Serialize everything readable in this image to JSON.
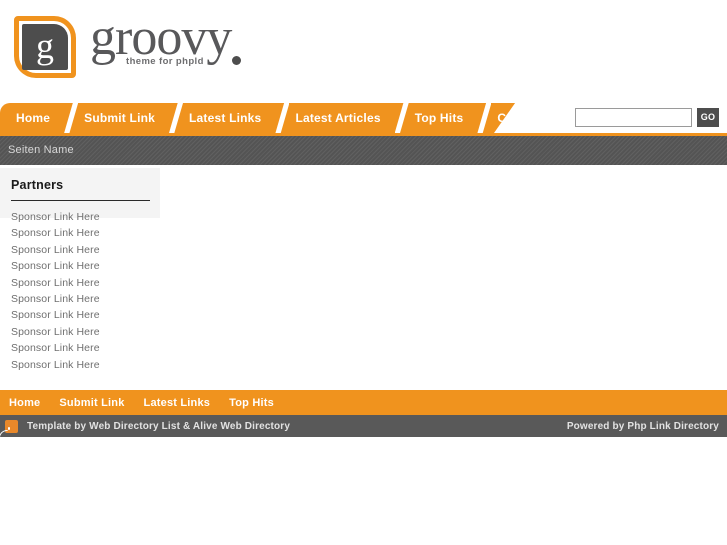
{
  "header": {
    "logo": {
      "mark_letter": "g",
      "word": "groovy",
      "tagline": "theme for phpld",
      "accent_color": "#F0931E",
      "dark_color": "#4d4d4d"
    }
  },
  "mainnav": {
    "items": [
      {
        "label": "Home"
      },
      {
        "label": "Submit Link"
      },
      {
        "label": "Latest Links"
      },
      {
        "label": "Latest Articles"
      },
      {
        "label": "Top Hits"
      },
      {
        "label": "Contact Us"
      }
    ]
  },
  "search": {
    "value": "",
    "placeholder": "",
    "button_label": "GO"
  },
  "titlebar": {
    "text": "Seiten Name"
  },
  "sidebar": {
    "partners": {
      "title": "Partners",
      "links": [
        {
          "label": "Sponsor Link Here"
        },
        {
          "label": "Sponsor Link Here"
        },
        {
          "label": "Sponsor Link Here"
        },
        {
          "label": "Sponsor Link Here"
        },
        {
          "label": "Sponsor Link Here"
        },
        {
          "label": "Sponsor Link Here"
        },
        {
          "label": "Sponsor Link Here"
        },
        {
          "label": "Sponsor Link Here"
        },
        {
          "label": "Sponsor Link Here"
        },
        {
          "label": "Sponsor Link Here"
        }
      ]
    }
  },
  "footernav": {
    "items": [
      {
        "label": "Home"
      },
      {
        "label": "Submit Link"
      },
      {
        "label": "Latest Links"
      },
      {
        "label": "Top Hits"
      }
    ]
  },
  "footer": {
    "rss_icon": "rss-icon",
    "credit": "Template by Web Directory List & Alive Web Directory",
    "powered_by": "Powered by Php Link Directory"
  },
  "colors": {
    "accent_orange": "#F0931E",
    "dark_gray": "#595959",
    "panel_gray": "#f4f4f4",
    "link_gray": "#6f6f6f"
  }
}
